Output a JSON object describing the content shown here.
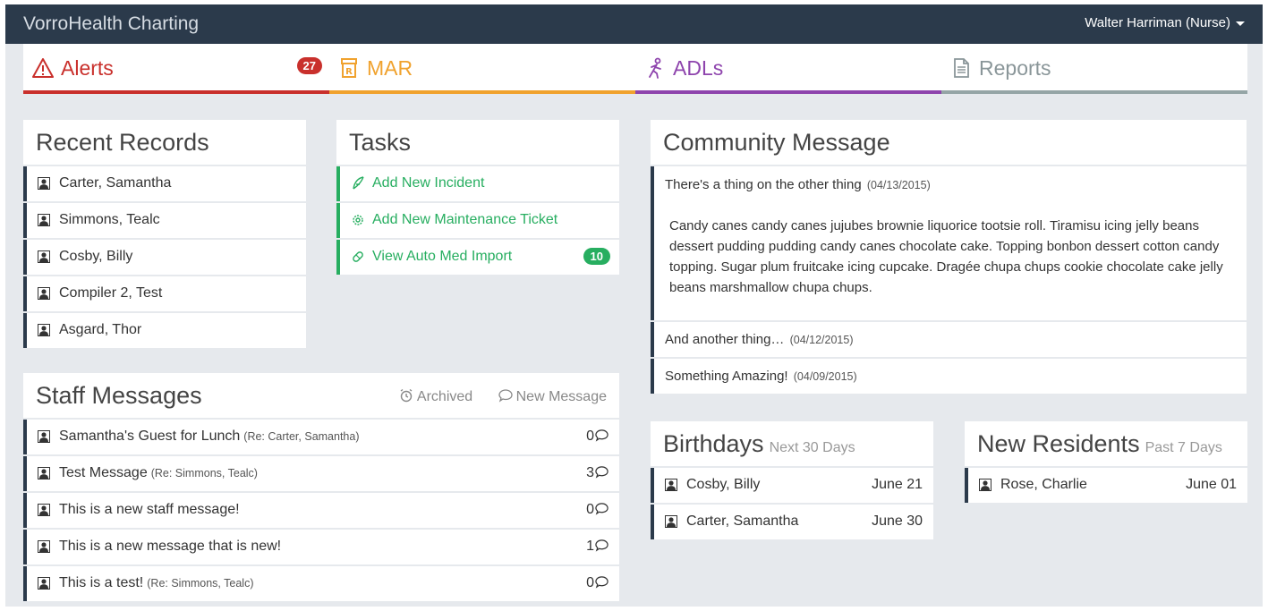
{
  "app": {
    "title": "VorroHealth Charting"
  },
  "user": {
    "name": "Walter Harriman (Nurse)"
  },
  "tabs": [
    {
      "label": "Alerts",
      "badge": "27",
      "color": "#c9302c"
    },
    {
      "label": "MAR",
      "color": "#f0a22e"
    },
    {
      "label": "ADLs",
      "color": "#8e44ad"
    },
    {
      "label": "Reports",
      "color": "#95a5a6"
    }
  ],
  "recent_records": {
    "title": "Recent Records",
    "items": [
      "Carter, Samantha",
      "Simmons, Tealc",
      "Cosby, Billy",
      "Compiler 2, Test",
      "Asgard, Thor"
    ]
  },
  "tasks": {
    "title": "Tasks",
    "items": [
      {
        "label": "Add New Incident",
        "icon": "feather-icon"
      },
      {
        "label": "Add New Maintenance Ticket",
        "icon": "gear-icon"
      },
      {
        "label": "View Auto Med Import",
        "icon": "pills-icon",
        "badge": "10"
      }
    ]
  },
  "staff_messages": {
    "title": "Staff Messages",
    "archived_label": "Archived",
    "new_message_label": "New Message",
    "items": [
      {
        "subject": "Samantha's Guest for Lunch",
        "re": "(Re: Carter, Samantha)",
        "count": "0"
      },
      {
        "subject": "Test Message",
        "re": "(Re: Simmons, Tealc)",
        "count": "3"
      },
      {
        "subject": "This is a new staff message!",
        "re": "",
        "count": "0"
      },
      {
        "subject": "This is a new message that is new!",
        "re": "",
        "count": "1"
      },
      {
        "subject": "This is a test!",
        "re": "(Re: Simmons, Tealc)",
        "count": "0"
      }
    ]
  },
  "community": {
    "title": "Community Message",
    "main": {
      "title": "There's a thing on the other thing",
      "date": "(04/13/2015)",
      "body": "Candy canes candy canes jujubes brownie liquorice tootsie roll. Tiramisu icing jelly beans dessert pudding pudding candy canes chocolate cake. Topping bonbon dessert cotton candy topping. Sugar plum fruitcake icing cupcake. Dragée chupa chups cookie chocolate cake jelly beans marshmallow chupa chups."
    },
    "others": [
      {
        "title": "And another thing…",
        "date": "(04/12/2015)"
      },
      {
        "title": "Something Amazing!",
        "date": "(04/09/2015)"
      }
    ]
  },
  "birthdays": {
    "title": "Birthdays",
    "subtitle": "Next 30 Days",
    "items": [
      {
        "name": "Cosby, Billy",
        "date": "June 21"
      },
      {
        "name": "Carter, Samantha",
        "date": "June 30"
      }
    ]
  },
  "new_residents": {
    "title": "New Residents",
    "subtitle": "Past 7 Days",
    "items": [
      {
        "name": "Rose, Charlie",
        "date": "June 01"
      }
    ]
  }
}
